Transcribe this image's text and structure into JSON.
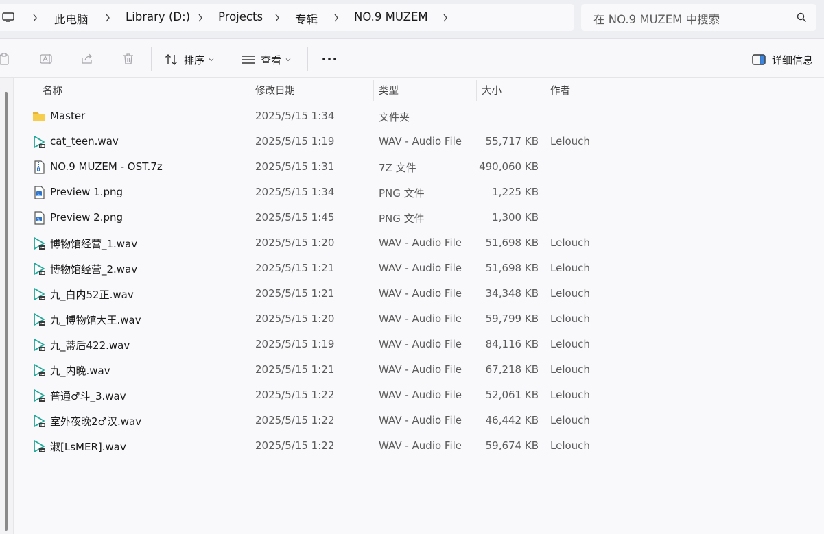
{
  "address": {
    "crumbs": [
      "此电脑",
      "Library (D:)",
      "Projects",
      "专辑",
      "NO.9 MUZEM"
    ],
    "search_placeholder": "在 NO.9 MUZEM 中搜索"
  },
  "toolbar": {
    "sort_label": "排序",
    "view_label": "查看",
    "details_label": "详细信息"
  },
  "columns": {
    "name": "名称",
    "date": "修改日期",
    "type": "类型",
    "size": "大小",
    "author": "作者"
  },
  "files": [
    {
      "icon": "folder-icon",
      "name": "Master",
      "date": "2025/5/15 1:34",
      "type": "文件夹",
      "size": "",
      "author": ""
    },
    {
      "icon": "wav-file-icon",
      "name": "cat_teen.wav",
      "date": "2025/5/15 1:19",
      "type": "WAV - Audio File",
      "size": "55,717 KB",
      "author": "Lelouch"
    },
    {
      "icon": "archive-file-icon",
      "name": "NO.9 MUZEM - OST.7z",
      "date": "2025/5/15 1:31",
      "type": "7Z 文件",
      "size": "490,060 KB",
      "author": ""
    },
    {
      "icon": "png-file-icon",
      "name": "Preview 1.png",
      "date": "2025/5/15 1:34",
      "type": "PNG 文件",
      "size": "1,225 KB",
      "author": ""
    },
    {
      "icon": "png-file-icon",
      "name": "Preview 2.png",
      "date": "2025/5/15 1:45",
      "type": "PNG 文件",
      "size": "1,300 KB",
      "author": ""
    },
    {
      "icon": "wav-file-icon",
      "name": "博物馆经营_1.wav",
      "date": "2025/5/15 1:20",
      "type": "WAV - Audio File",
      "size": "51,698 KB",
      "author": "Lelouch"
    },
    {
      "icon": "wav-file-icon",
      "name": "博物馆经营_2.wav",
      "date": "2025/5/15 1:21",
      "type": "WAV - Audio File",
      "size": "51,698 KB",
      "author": "Lelouch"
    },
    {
      "icon": "wav-file-icon",
      "name": "九_白内52正.wav",
      "date": "2025/5/15 1:21",
      "type": "WAV - Audio File",
      "size": "34,348 KB",
      "author": "Lelouch"
    },
    {
      "icon": "wav-file-icon",
      "name": "九_博物馆大王.wav",
      "date": "2025/5/15 1:20",
      "type": "WAV - Audio File",
      "size": "59,799 KB",
      "author": "Lelouch"
    },
    {
      "icon": "wav-file-icon",
      "name": "九_蒂后422.wav",
      "date": "2025/5/15 1:19",
      "type": "WAV - Audio File",
      "size": "84,116 KB",
      "author": "Lelouch"
    },
    {
      "icon": "wav-file-icon",
      "name": "九_内晚.wav",
      "date": "2025/5/15 1:21",
      "type": "WAV - Audio File",
      "size": "67,218 KB",
      "author": "Lelouch"
    },
    {
      "icon": "wav-file-icon",
      "name": "普通♂斗_3.wav",
      "date": "2025/5/15 1:22",
      "type": "WAV - Audio File",
      "size": "52,061 KB",
      "author": "Lelouch"
    },
    {
      "icon": "wav-file-icon",
      "name": "室外夜晚2♂汉.wav",
      "date": "2025/5/15 1:22",
      "type": "WAV - Audio File",
      "size": "46,442 KB",
      "author": "Lelouch"
    },
    {
      "icon": "wav-file-icon",
      "name": "淑[LsMER].wav",
      "date": "2025/5/15 1:22",
      "type": "WAV - Audio File",
      "size": "59,674 KB",
      "author": "Lelouch"
    }
  ],
  "colors": {
    "folder": "#f5c542",
    "wav_accent": "#21a89a",
    "png_accent": "#2f73c8"
  }
}
